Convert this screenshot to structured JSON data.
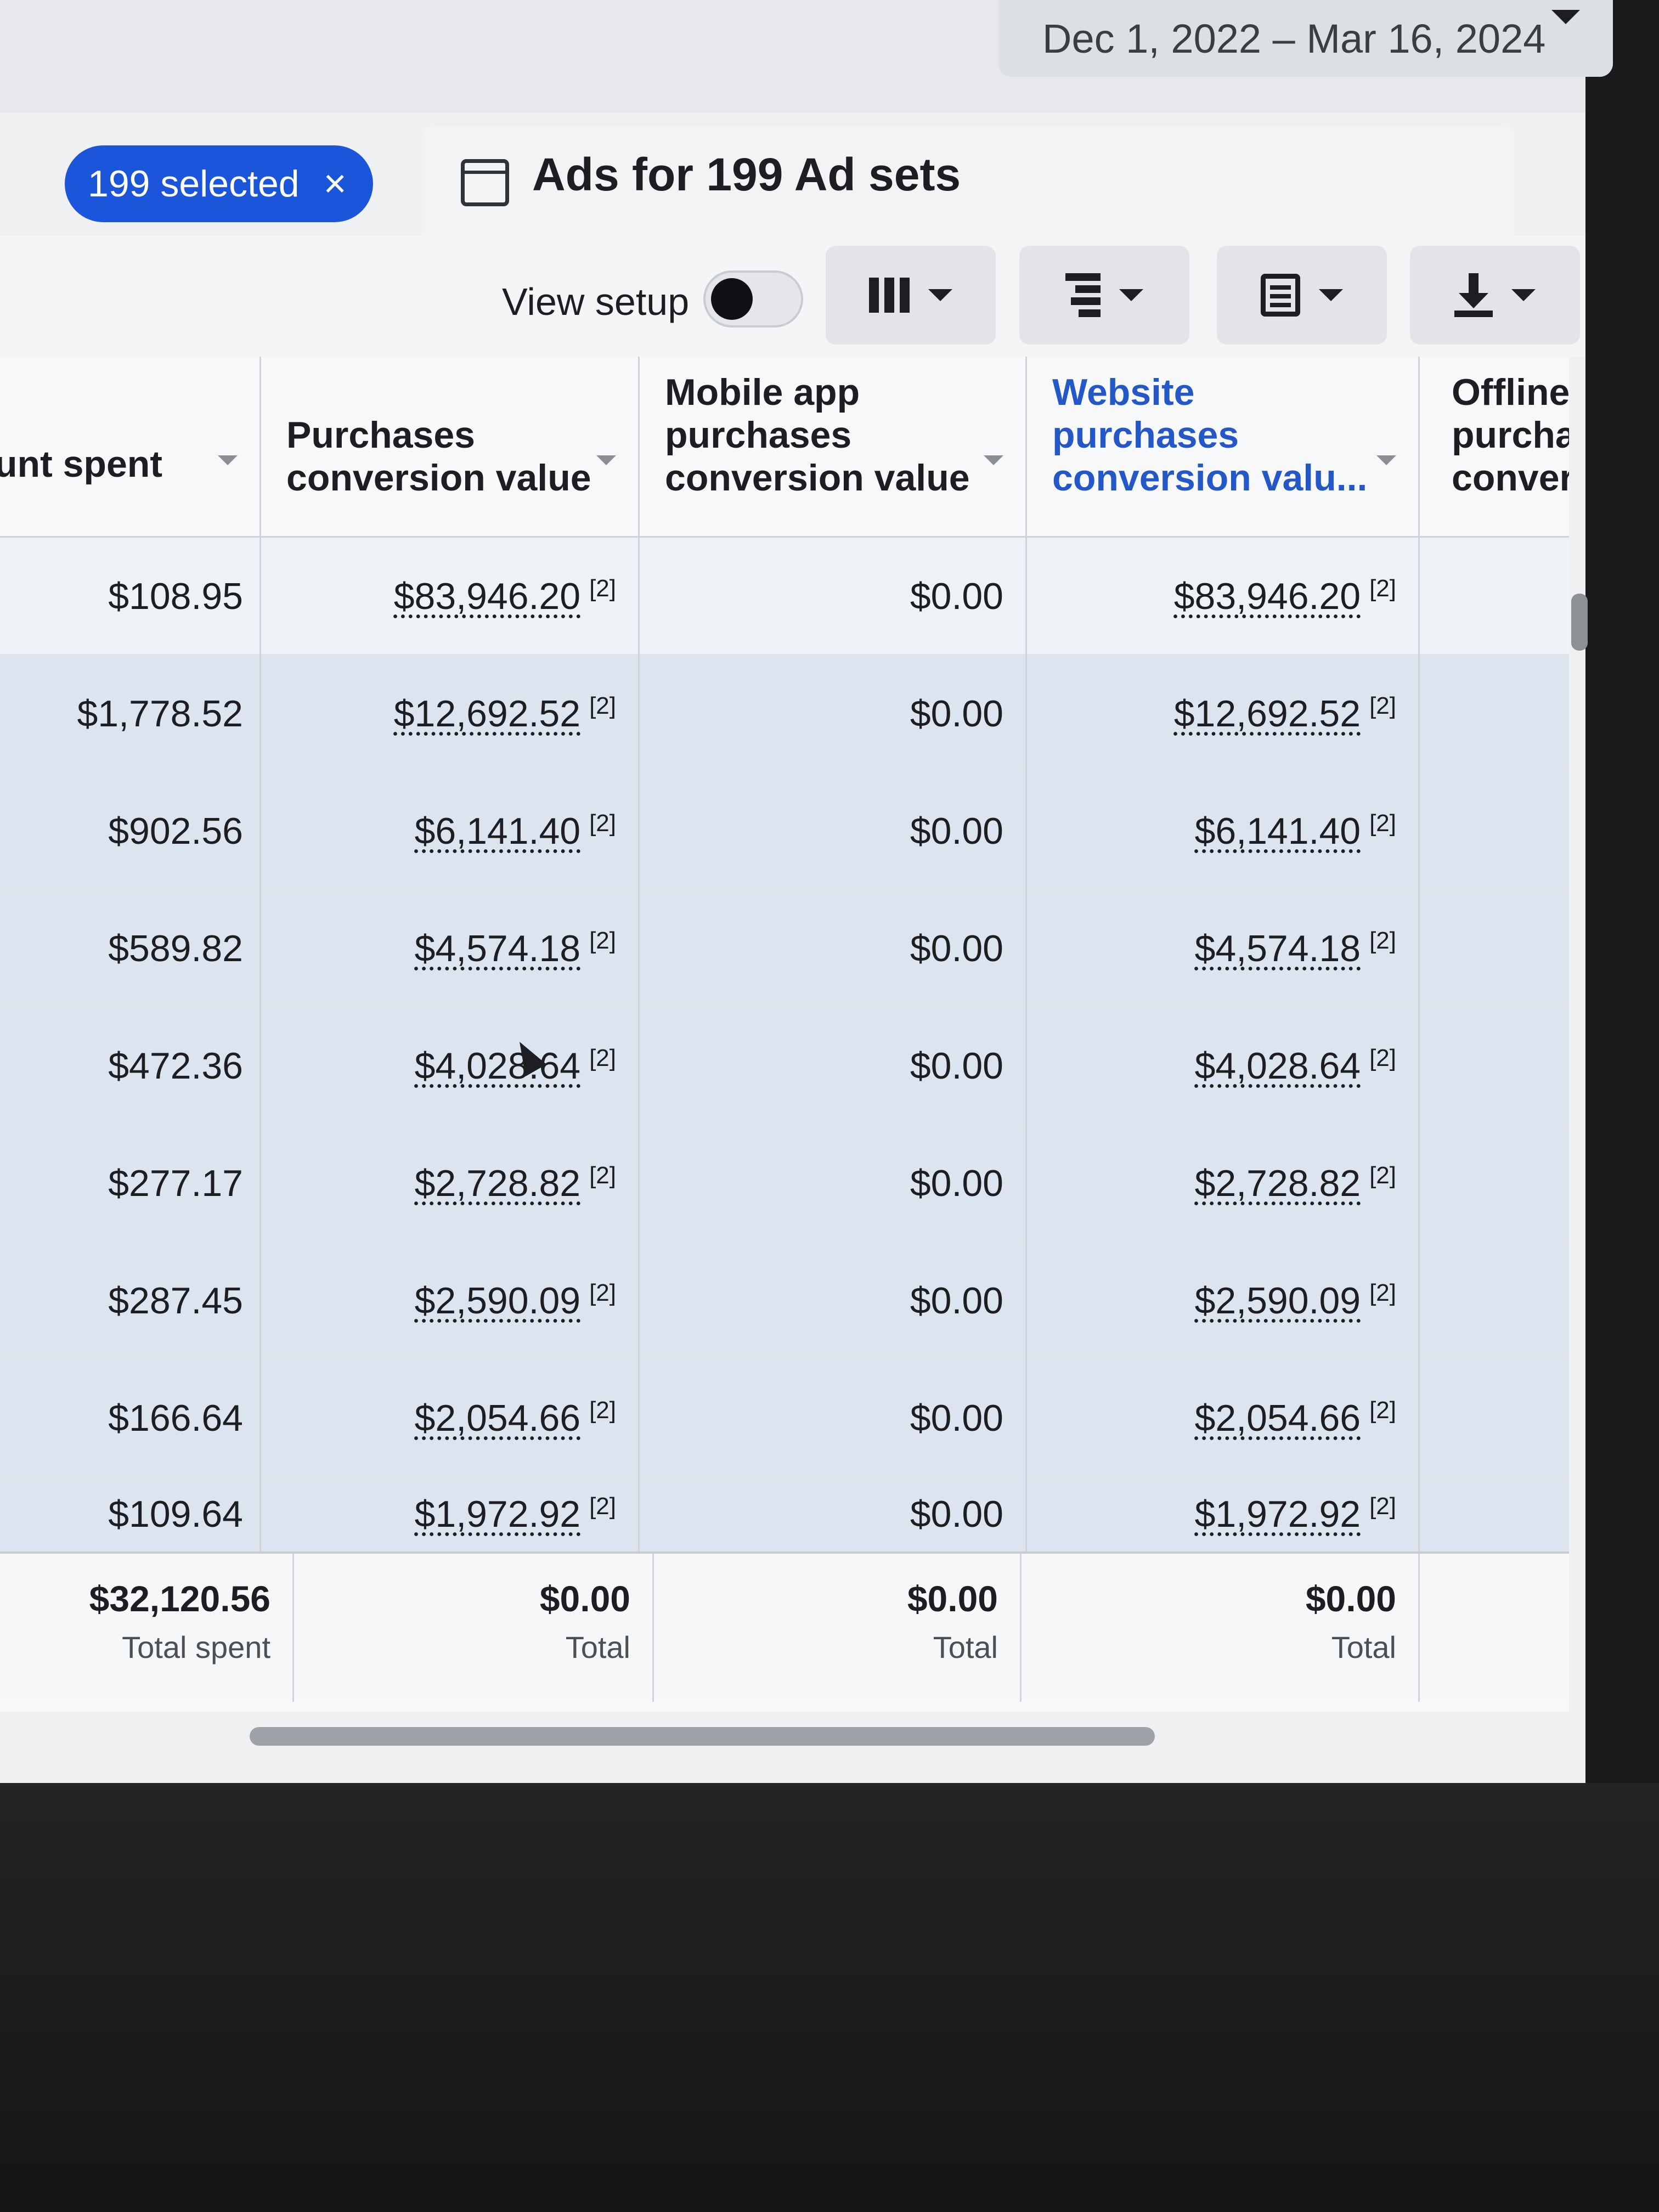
{
  "header": {
    "date_range": "Dec 1, 2022 – Mar 16, 2024"
  },
  "selection": {
    "label": "199 selected",
    "clear_icon": "×"
  },
  "tab": {
    "label": "Ads for 199 Ad sets"
  },
  "toolbar": {
    "view_setup_label": "View setup",
    "view_setup_enabled": false,
    "buttons": [
      "columns-icon",
      "breakdown-icon",
      "reports-icon",
      "export-icon"
    ]
  },
  "table": {
    "columns": [
      {
        "label": "unt spent"
      },
      {
        "label": "Purchases conversion value"
      },
      {
        "label": "Mobile app purchases conversion value"
      },
      {
        "label": "Website purchases conversion valu..."
      },
      {
        "label": "Offline purchase conversi"
      }
    ],
    "footnote": "[2]",
    "rows": [
      {
        "spent": "$108.95",
        "purchases": "$83,946.20",
        "mobile": "$0.00",
        "website": "$83,946.20"
      },
      {
        "spent": "$1,778.52",
        "purchases": "$12,692.52",
        "mobile": "$0.00",
        "website": "$12,692.52"
      },
      {
        "spent": "$902.56",
        "purchases": "$6,141.40",
        "mobile": "$0.00",
        "website": "$6,141.40"
      },
      {
        "spent": "$589.82",
        "purchases": "$4,574.18",
        "mobile": "$0.00",
        "website": "$4,574.18"
      },
      {
        "spent": "$472.36",
        "purchases": "$4,028.64",
        "mobile": "$0.00",
        "website": "$4,028.64"
      },
      {
        "spent": "$277.17",
        "purchases": "$2,728.82",
        "mobile": "$0.00",
        "website": "$2,728.82"
      },
      {
        "spent": "$287.45",
        "purchases": "$2,590.09",
        "mobile": "$0.00",
        "website": "$2,590.09"
      },
      {
        "spent": "$166.64",
        "purchases": "$2,054.66",
        "mobile": "$0.00",
        "website": "$2,054.66"
      },
      {
        "spent": "$109.64",
        "purchases": "$1,972.92",
        "mobile": "$0.00",
        "website": "$1,972.92"
      }
    ],
    "totals": {
      "spent": {
        "value": "$32,120.56",
        "label": "Total spent"
      },
      "purchases": {
        "value": "$0.00",
        "label": "Total"
      },
      "mobile": {
        "value": "$0.00",
        "label": "Total"
      },
      "website": {
        "value": "$0.00",
        "label": "Total"
      }
    }
  }
}
